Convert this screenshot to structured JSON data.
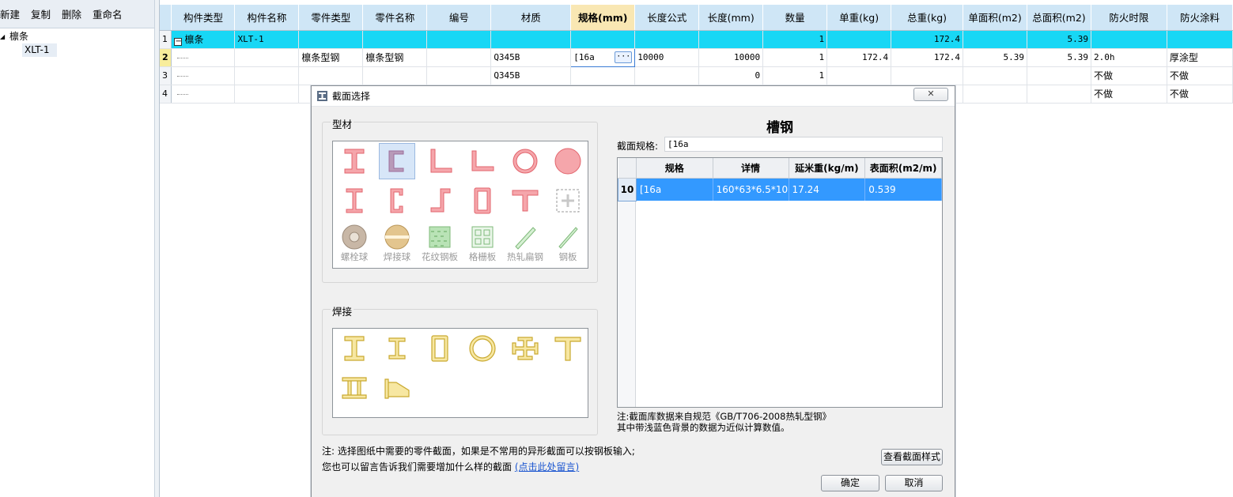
{
  "left_toolbar": {
    "new": "新建",
    "copy": "复制",
    "delete": "删除",
    "rename": "重命名"
  },
  "tree": {
    "root": "檩条",
    "child": "XLT-1"
  },
  "grid": {
    "headers": [
      "构件类型",
      "构件名称",
      "零件类型",
      "零件名称",
      "编号",
      "材质",
      "规格(mm)",
      "长度公式",
      "长度(mm)",
      "数量",
      "单重(kg)",
      "总重(kg)",
      "单面积(m2)",
      "总面积(m2)",
      "防火时限",
      "防火涂料"
    ],
    "rows": [
      {
        "n": "1",
        "c": [
          "檩条",
          "XLT-1",
          "",
          "",
          "",
          "",
          "",
          "",
          "",
          "1",
          "",
          "172.4",
          "",
          "5.39",
          "",
          ""
        ]
      },
      {
        "n": "2",
        "c": [
          "",
          "",
          "檩条型钢",
          "檩条型钢",
          "",
          "Q345B",
          "[16a",
          "10000",
          "10000",
          "1",
          "172.4",
          "172.4",
          "5.39",
          "5.39",
          "2.0h",
          "厚涂型"
        ]
      },
      {
        "n": "3",
        "c": [
          "",
          "",
          "",
          "",
          "",
          "Q345B",
          "",
          "",
          "0",
          "1",
          "",
          "",
          "",
          "",
          "不做",
          "不做"
        ]
      },
      {
        "n": "4",
        "c": [
          "",
          "",
          "",
          "",
          "",
          "",
          "",
          "",
          "",
          "",
          "",
          "",
          "",
          "",
          "不做",
          "不做"
        ]
      }
    ],
    "edit_button": "···"
  },
  "dialog": {
    "title": "截面选择",
    "close": "✕",
    "group_profile": "型材",
    "group_weld": "焊接",
    "profile_captions": [
      "螺栓球",
      "焊接球",
      "花纹钢板",
      "格栅板",
      "热轧扁钢",
      "钢板"
    ],
    "right_title": "槽钢",
    "spec_label": "截面规格:",
    "spec_value": "[16a",
    "table_headers": [
      "规格",
      "详情",
      "延米重(kg/m)",
      "表面积(m2/m)"
    ],
    "table_row": {
      "n": "10",
      "c": [
        "[16a",
        "160*63*6.5*10",
        "17.24",
        "0.539"
      ]
    },
    "note_right_1": "注:截面库数据来自规范《GB/T706-2008热轧型钢》",
    "note_right_2": "其中带浅蓝色背景的数据为近似计算数值。",
    "note_left_1": "注: 选择图纸中需要的零件截面，如果是不常用的异形截面可以按钢板输入;",
    "note_left_2": "您也可以留言告诉我们需要增加什么样的截面",
    "note_link": "(点击此处留言)",
    "btn_view": "查看截面样式",
    "btn_ok": "确定",
    "btn_cancel": "取消"
  },
  "colors": {
    "profile_red": "#f07f86",
    "weld_gold": "#d4b73d",
    "selected_row": "#18d7f5",
    "selected_header": "#f9e7b3"
  }
}
